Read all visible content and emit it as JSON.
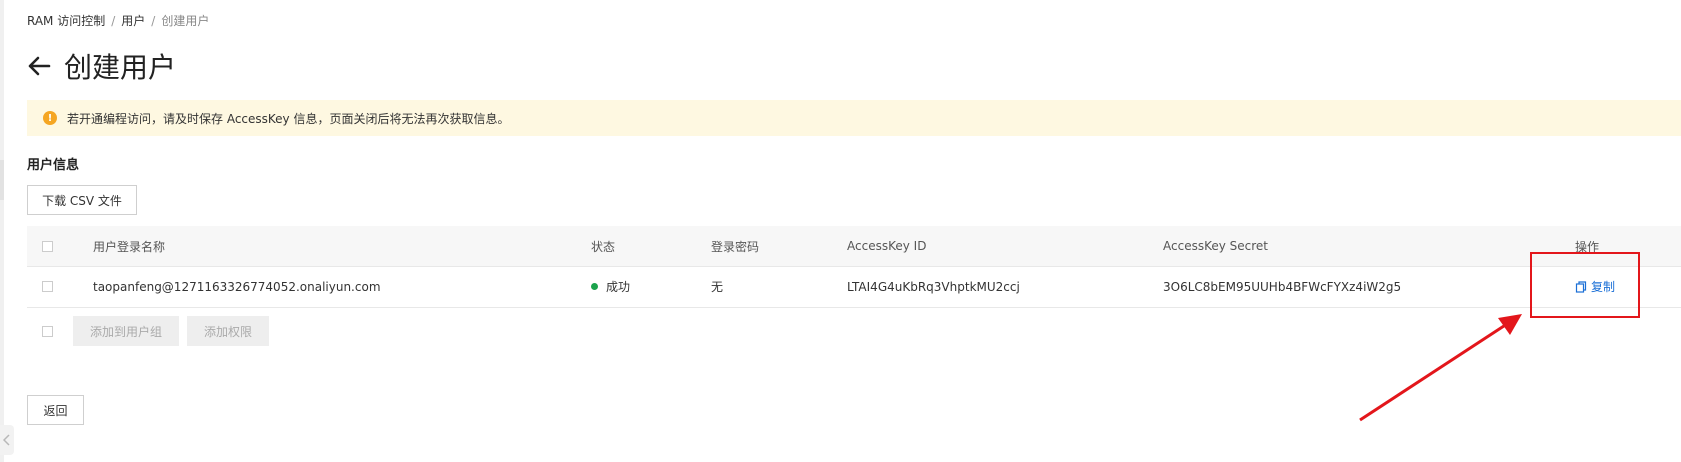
{
  "breadcrumb": {
    "root": "RAM 访问控制",
    "sep1": "/",
    "section": "用户",
    "sep2": "/",
    "current": "创建用户"
  },
  "page": {
    "title": "创建用户",
    "back_icon": "arrow-left-icon"
  },
  "alert": {
    "icon": "warning-icon",
    "icon_glyph": "!",
    "text": "若开通编程访问，请及时保存 AccessKey 信息，页面关闭后将无法再次获取信息。",
    "bg_color": "#fef8e1",
    "icon_color": "#f5a623"
  },
  "section": {
    "title": "用户信息"
  },
  "buttons": {
    "download_csv": "下载 CSV 文件",
    "add_to_group": "添加到用户组",
    "add_permission": "添加权限",
    "back": "返回"
  },
  "table": {
    "columns": {
      "name": "用户登录名称",
      "status": "状态",
      "password": "登录密码",
      "access_key_id": "AccessKey ID",
      "access_key_secret": "AccessKey Secret",
      "action": "操作"
    },
    "rows": [
      {
        "name": "taopanfeng@1271163326774052.onaliyun.com",
        "status": "成功",
        "password": "无",
        "access_key_id": "LTAI4G4uKbRq3VhptkMU2ccj",
        "access_key_secret": "3O6LC8bEM95UUHb4BFWcFYXz4iW2g5",
        "action": "复制",
        "action_icon": "copy-icon"
      }
    ]
  },
  "colors": {
    "success": "#1ba34c",
    "link": "#1a6fd6",
    "annotation": "#e3161b"
  }
}
